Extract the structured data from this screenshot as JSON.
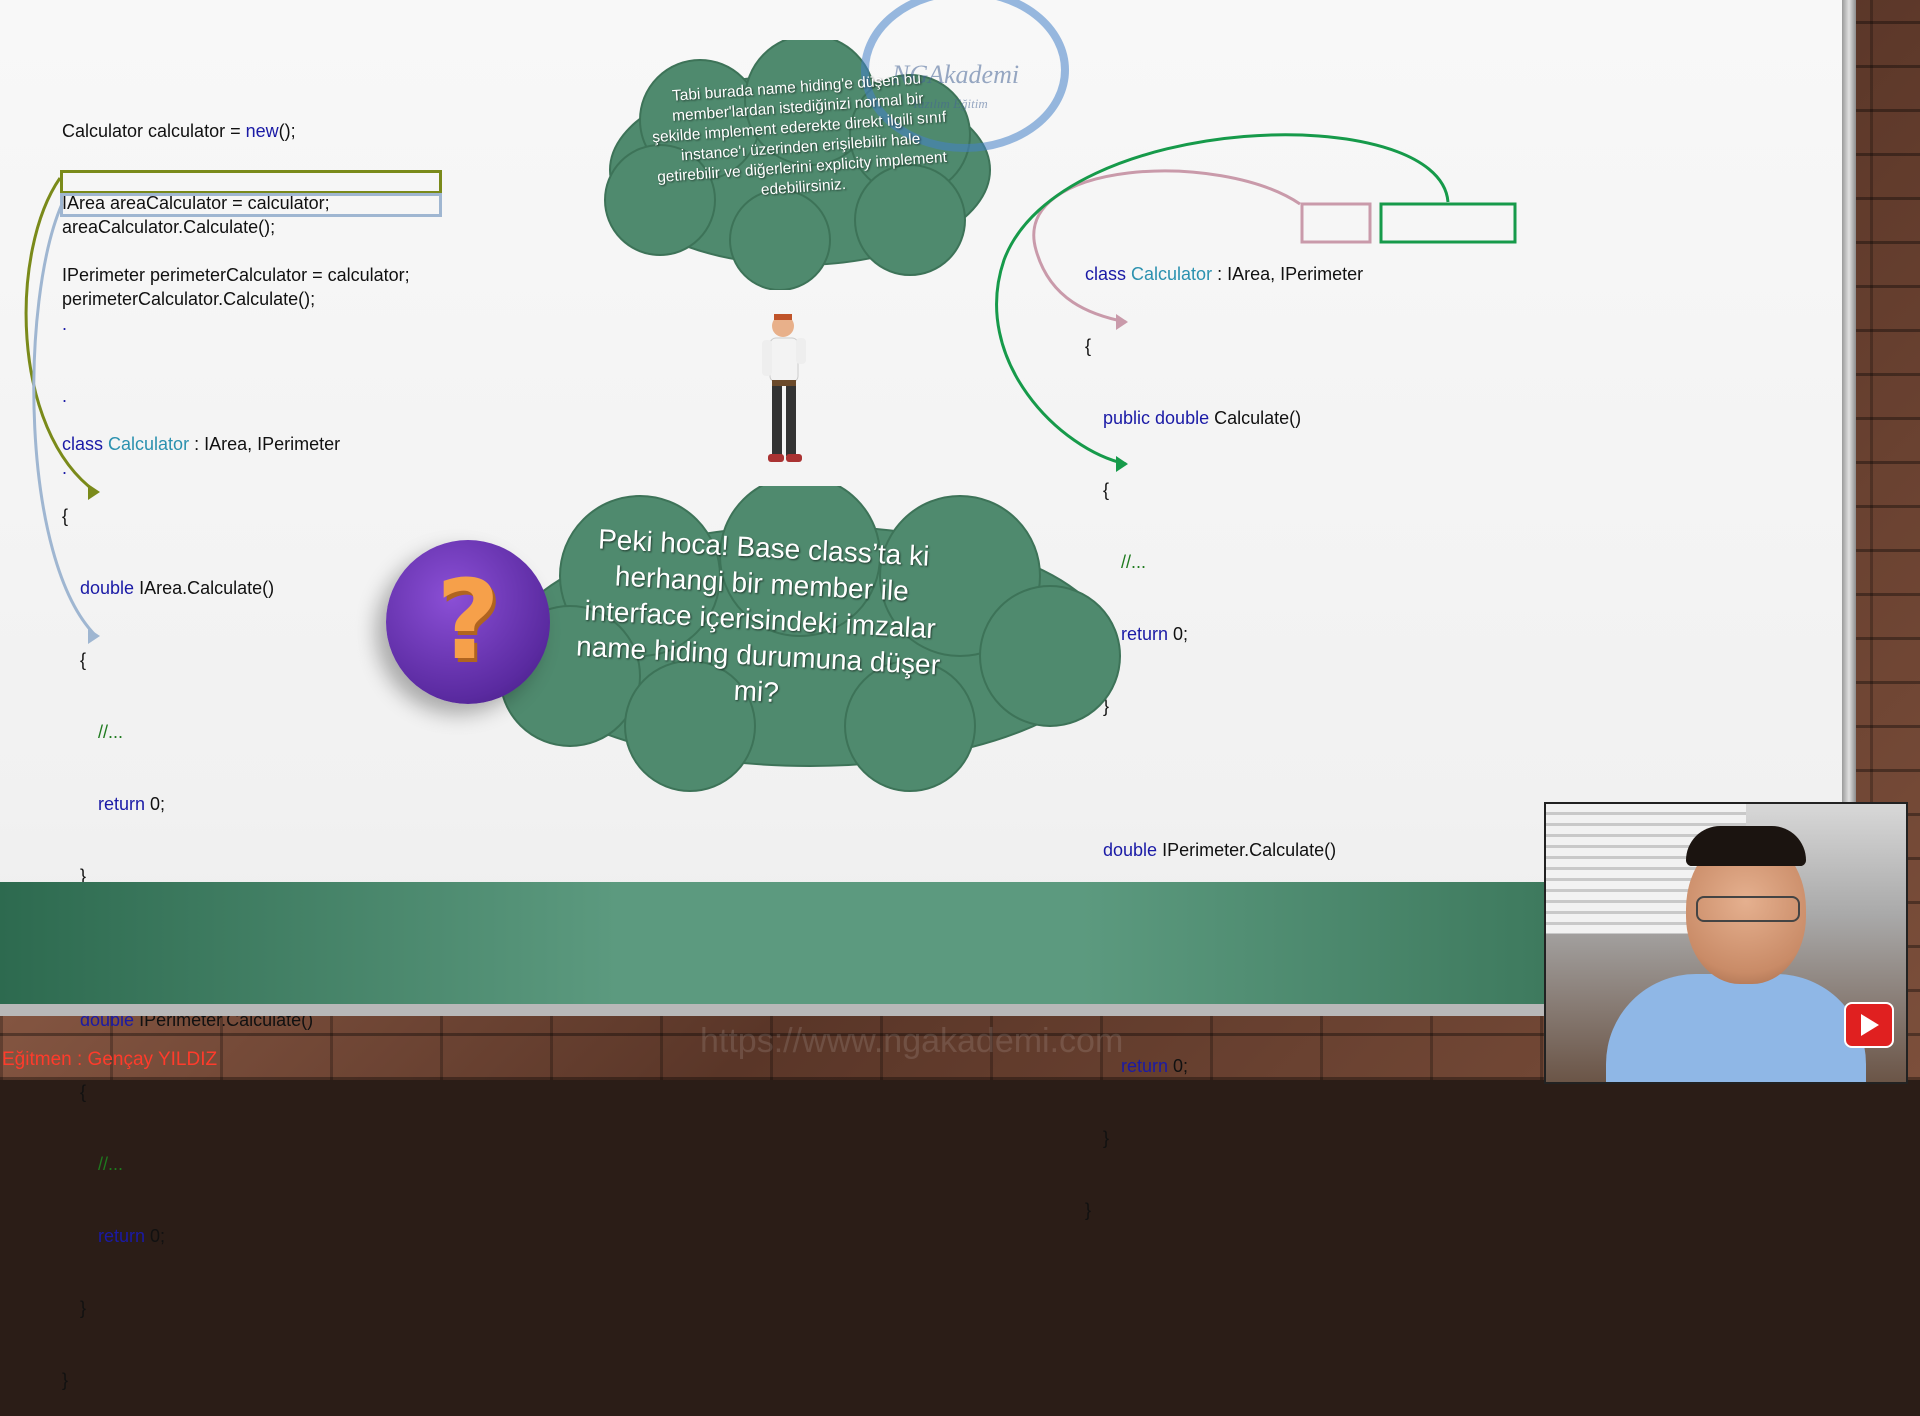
{
  "code_left_top": {
    "line1_a": "Calculator calculator = ",
    "line1_kw": "new",
    "line1_b": "();",
    "line2": "IArea areaCalculator = calculator;",
    "line3": "IPerimeter perimeterCalculator = calculator;",
    "call1": "areaCalculator.Calculate();",
    "call2": "perimeterCalculator.Calculate();",
    "dots": [
      ".",
      ".",
      "."
    ]
  },
  "code_left_class": {
    "kw_class": "class",
    "class_name": "Calculator",
    "inherit": " : IArea, IPerimeter",
    "brace_open": "{",
    "brace_close": "}",
    "m1_kw": "double",
    "m1_sig": " IArea.Calculate()",
    "m2_kw": "double",
    "m2_sig": " IPerimeter.Calculate()",
    "comment": "//...",
    "ret_kw": "return",
    "ret_val": " 0;"
  },
  "code_right_class": {
    "kw_class": "class",
    "class_name": "Calculator",
    "inherit": " : IArea, IPerimeter",
    "brace_open": "{",
    "brace_close": "}",
    "m1_kw": "public double",
    "m1_sig": " Calculate()",
    "m2_kw": "double",
    "m2_sig": " IPerimeter.Calculate()",
    "comment": "//...",
    "ret_kw": "return",
    "ret_val": " 0;"
  },
  "top_cloud_text": "Tabi burada name hiding'e düşen bu member'lardan istediğinizi normal bir şekilde implement ederekte direkt ilgili sınıf instance'ı üzerinden erişilebilir hale getirebilir ve diğerlerini explicity implement edebilirsiniz.",
  "bottom_cloud_text": "Peki hoca! Base class’ta ki herhangi bir member ile interface içerisindeki imzalar name hiding durumuna düşer mi?",
  "question_mark": "?",
  "logo": {
    "name": "NGAkademi",
    "tagline": "Yazılım Eğitim"
  },
  "footer": {
    "instructor": "Eğitmen : Gençay YILDIZ",
    "watermark": "https://www.ngakademi.com"
  },
  "colors": {
    "cloud_green": "#4f8a6e",
    "keyword_blue": "#1a1aa6",
    "type_teal": "#2b91af",
    "comment_green": "#1e7a1e",
    "arrow_olive": "#7a8a1a",
    "arrow_lightblue": "#9fb6d1",
    "arrow_pink": "#c99aaa",
    "arrow_green": "#169a4a",
    "instructor_red": "#ff3b2b"
  }
}
